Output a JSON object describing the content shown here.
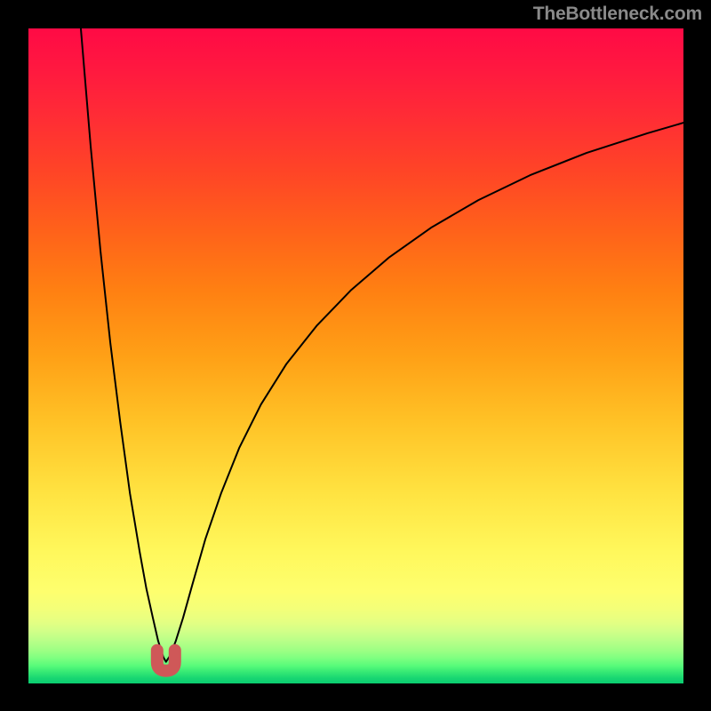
{
  "watermark": "TheBottleneck.com",
  "chart_data": {
    "type": "line",
    "title": "",
    "xlabel": "",
    "ylabel": "",
    "xlim": [
      0,
      100
    ],
    "ylim": [
      0,
      100
    ],
    "annotations": [
      {
        "name": "marker-at-minimum",
        "x": 21,
        "y": 3.3
      }
    ],
    "series": [
      {
        "name": "left-branch",
        "x": [
          8.0,
          9.5,
          11.0,
          12.5,
          14.0,
          15.5,
          17.0,
          18.0,
          19.0,
          19.8,
          20.6,
          21.0
        ],
        "y": [
          100.0,
          82.0,
          66.0,
          52.0,
          40.0,
          29.0,
          20.0,
          14.5,
          10.0,
          6.5,
          4.0,
          3.3
        ]
      },
      {
        "name": "right-branch",
        "x": [
          21.0,
          21.6,
          22.5,
          23.6,
          25.0,
          27.0,
          29.4,
          32.2,
          35.5,
          39.4,
          44.0,
          49.2,
          55.0,
          61.5,
          68.7,
          76.6,
          85.2,
          94.5,
          100.0
        ],
        "y": [
          3.3,
          4.2,
          6.5,
          10.0,
          15.0,
          22.0,
          29.0,
          36.0,
          42.6,
          48.8,
          54.6,
          60.0,
          65.0,
          69.6,
          73.8,
          77.6,
          81.0,
          84.0,
          85.6
        ]
      }
    ],
    "background_gradient_stops": [
      {
        "pos": 0.0,
        "color": "#ff0a45"
      },
      {
        "pos": 0.5,
        "color": "#ffa016"
      },
      {
        "pos": 0.8,
        "color": "#fff85c"
      },
      {
        "pos": 0.93,
        "color": "#b8ff88"
      },
      {
        "pos": 1.0,
        "color": "#0acc70"
      }
    ]
  }
}
